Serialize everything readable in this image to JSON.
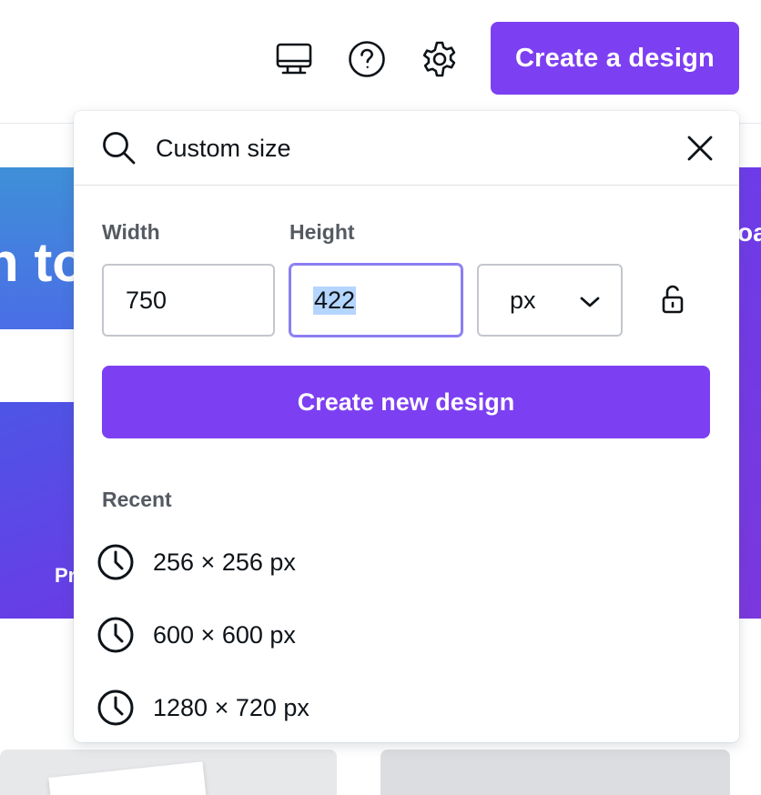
{
  "header": {
    "icons": [
      "monitor-icon",
      "help-icon",
      "settings-icon"
    ],
    "create_button_label": "Create a design"
  },
  "background": {
    "banner_text": "n to",
    "card_text": "Pr",
    "right_text": "oa"
  },
  "dropdown": {
    "search": {
      "value": "Custom size",
      "placeholder": "Custom size"
    },
    "width_label": "Width",
    "height_label": "Height",
    "width_value": "750",
    "height_value": "422",
    "unit_value": "px",
    "create_new_label": "Create new design",
    "recent_title": "Recent",
    "recent": [
      {
        "label": "256 × 256 px"
      },
      {
        "label": "600 × 600 px"
      },
      {
        "label": "1280 × 720 px"
      }
    ]
  },
  "colors": {
    "brand_purple": "#7d3ff2",
    "focus_border": "#8b7ef2",
    "selection": "#b4d5fe"
  }
}
